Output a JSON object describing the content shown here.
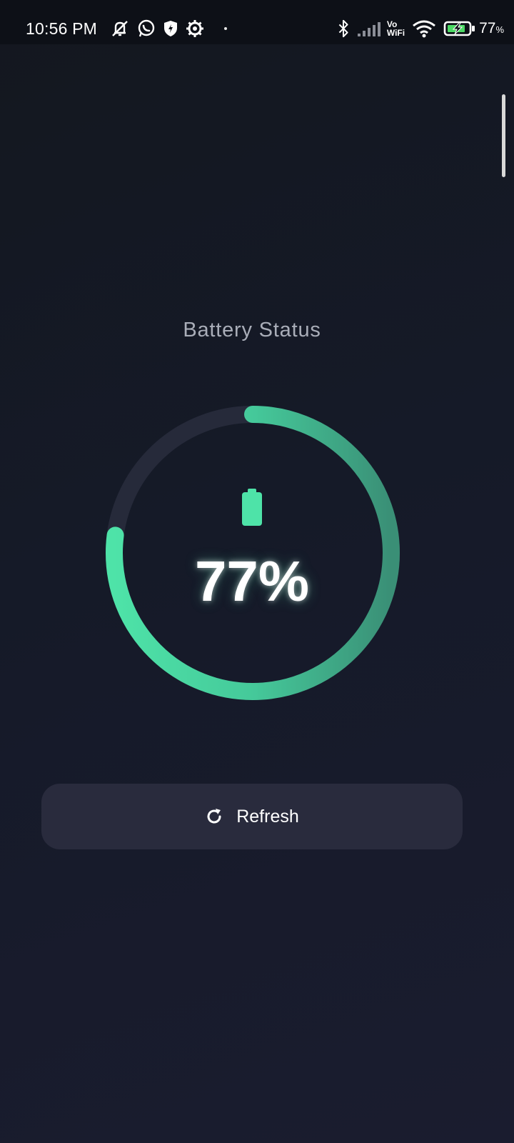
{
  "status_bar": {
    "time": "10:56 PM",
    "vo_label": "Vo",
    "wifi_label": "WiFi",
    "battery_level": "77",
    "battery_unit": "%",
    "icons": [
      "mute-icon",
      "whatsapp-icon",
      "shield-icon",
      "settings-icon",
      "bluetooth-icon",
      "signal-icon",
      "wifi-icon",
      "battery-charging-icon"
    ]
  },
  "main": {
    "title": "Battery Status",
    "percent_text": "77%",
    "battery_fraction": 0.77,
    "refresh_label": "Refresh"
  },
  "colors": {
    "accent": "#4ee3a8",
    "accent_dark": "#3a8f76",
    "track": "#262a3a",
    "button_bg": "#292b3d"
  }
}
